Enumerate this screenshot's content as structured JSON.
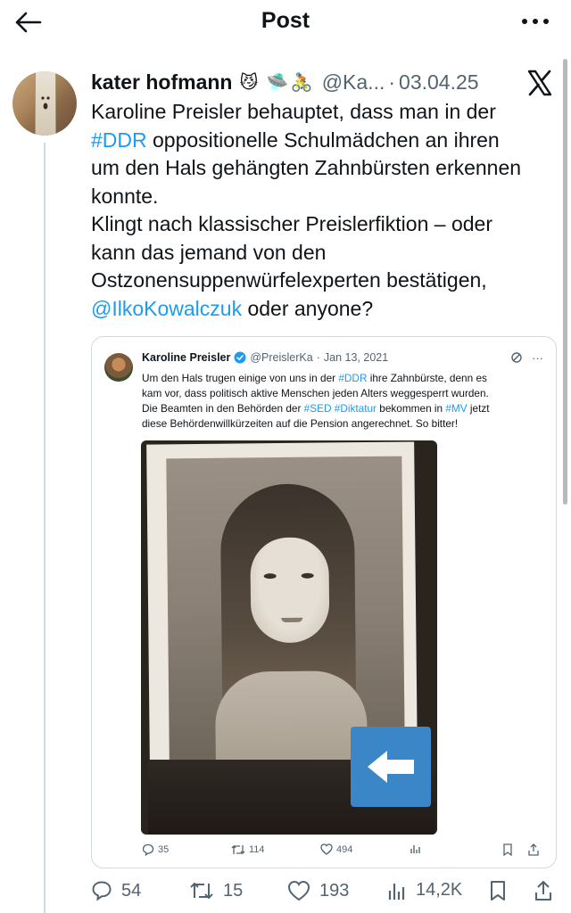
{
  "header": {
    "title": "Post"
  },
  "tweet": {
    "author_name": "kater hofmann",
    "emojis": "😼 🛸🚴",
    "handle": "@Ka...",
    "separator": "·",
    "date": "03.04.25",
    "text_lines": [
      {
        "pre": "Karoline Preisler behauptet, dass man in der",
        "tag": "",
        "post": ""
      },
      {
        "pre": "",
        "tag": "#DDR",
        "post": " oppositionelle Schulmädchen an ihren"
      },
      {
        "pre": "um den Hals gehängten Zahnbürsten erkennen",
        "tag": "",
        "post": ""
      },
      {
        "pre": "konnte.",
        "tag": "",
        "post": ""
      },
      {
        "pre": "Klingt nach klassischer Preislerfiktion – oder",
        "tag": "",
        "post": ""
      },
      {
        "pre": "kann das jemand von den",
        "tag": "",
        "post": ""
      },
      {
        "pre": "Ostzonensuppenwürfelexperten bestätigen,",
        "tag": "",
        "post": ""
      },
      {
        "pre": "",
        "tag": "@IlkoKowalczuk",
        "post": " oder anyone?"
      }
    ],
    "stats": {
      "replies": "54",
      "retweets": "15",
      "likes": "193",
      "views": "14,2K"
    }
  },
  "quote": {
    "name": "Karoline Preisler",
    "handle": "@PreislerKa",
    "separator": "·",
    "date": "Jan 13, 2021",
    "more": "···",
    "lines": [
      {
        "a": "Um den Hals trugen einige von uns in der ",
        "t1": "#DDR",
        "b": " ihre Zahnbürste, denn es",
        "t2": "",
        "c": "",
        "t3": "",
        "d": ""
      },
      {
        "a": "kam vor, dass politisch aktive Menschen jeden Alters weggesperrt wurden.",
        "t1": "",
        "b": "",
        "t2": "",
        "c": "",
        "t3": "",
        "d": ""
      },
      {
        "a": "Die Beamten in den Behörden der ",
        "t1": "#SED",
        "b": " ",
        "t2": "#Diktatur",
        "c": " bekommen in ",
        "t3": "#MV",
        "d": " jetzt"
      },
      {
        "a": "diese Behördenwillkürzeiten auf die Pension angerechnet. So bitter!",
        "t1": "",
        "b": "",
        "t2": "",
        "c": "",
        "t3": "",
        "d": ""
      }
    ],
    "stats": {
      "replies": "35",
      "retweets": "114",
      "likes": "494"
    }
  },
  "colors": {
    "link": "#1d9bf0",
    "muted": "#536471",
    "text": "#0f1419",
    "border": "#cfd9de",
    "badge": "#3b86c6"
  }
}
